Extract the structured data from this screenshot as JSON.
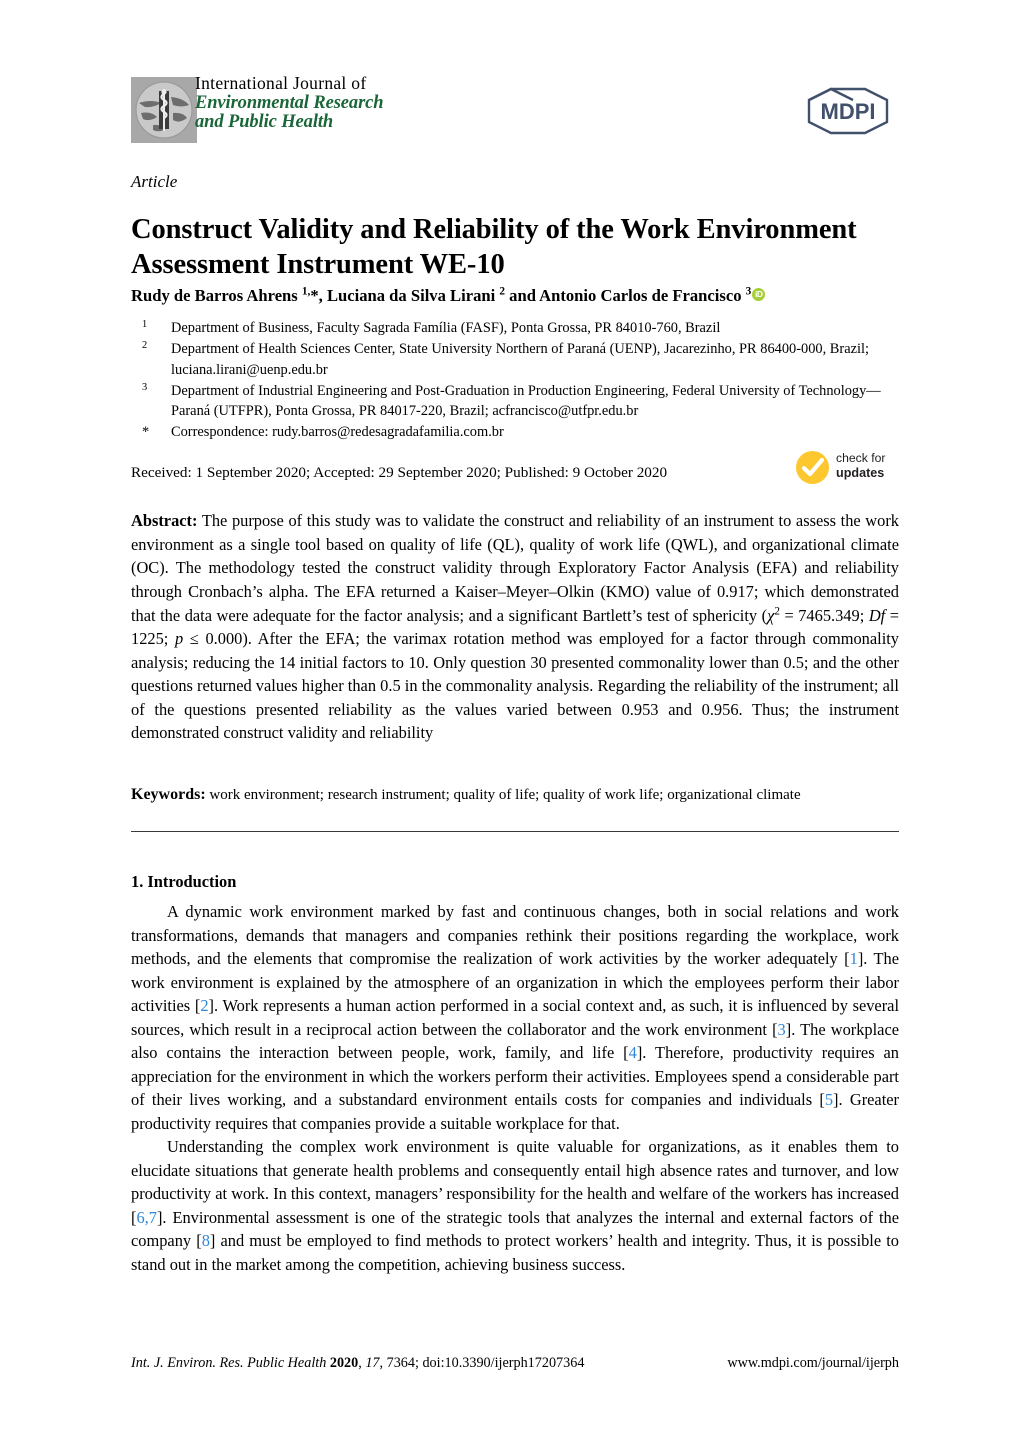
{
  "masthead": {
    "journal_line1": "International  Journal  of",
    "journal_line2": "Environmental Research",
    "journal_line3": "and Public Health",
    "publisher_logo_text": "MDPI",
    "journal_logo_name": "ijerph-globe-caduceus-logo",
    "green_hex": "#1b6638",
    "mdpi_navy_hex": "#41506b"
  },
  "article": {
    "type": "Article",
    "title": "Construct Validity and Reliability of the Work Environment Assessment Instrument WE-10"
  },
  "authors": {
    "line_html": "Rudy de Barros Ahrens <sup>1,</sup>*, Luciana da Silva Lirani <sup>2</sup> and Antonio Carlos de Francisco <sup>3</sup>",
    "orcid_label": "iD",
    "orcid_color": "#a6ce39"
  },
  "affiliations": [
    {
      "marker": "1",
      "text": "Department of Business, Faculty Sagrada Família (FASF), Ponta Grossa, PR 84010-760, Brazil"
    },
    {
      "marker": "2",
      "text": "Department of Health Sciences Center, State University Northern of Paraná (UENP), Jacarezinho, PR 86400-000, Brazil; luciana.lirani@uenp.edu.br"
    },
    {
      "marker": "3",
      "text": "Department of Industrial Engineering and Post-Graduation in Production Engineering, Federal University of Technology—Paraná (UTFPR), Ponta Grossa, PR 84017-220, Brazil; acfrancisco@utfpr.edu.br"
    },
    {
      "marker": "*",
      "text": "Correspondence: rudy.barros@redesagradafamilia.com.br"
    }
  ],
  "dates": {
    "line": "Received: 1 September 2020; Accepted: 29 September 2020; Published: 9 October 2020"
  },
  "check_for_updates": {
    "line1": "check for",
    "line2": "updates",
    "badge_color": "#fdc82f"
  },
  "abstract": {
    "label": "Abstract:",
    "text_html": "The purpose of this study was to validate the construct and reliability of an instrument to assess the work environment as a single tool based on quality of life (QL), quality of work life (QWL), and organizational climate (OC). The methodology tested the construct validity through Exploratory Factor Analysis (EFA) and reliability through Cronbach&rsquo;s alpha. The EFA returned a Kaiser&ndash;Meyer&ndash;Olkin (KMO) value of 0.917; which demonstrated that the data were adequate for the factor analysis; and a significant Bartlett&rsquo;s test of sphericity (<i>&chi;</i><sup>2</sup> = 7465.349; <i>Df</i> = 1225; <i>p</i> &le; 0.000). After the EFA; the varimax rotation method was employed for a factor through commonality analysis; reducing the 14 initial factors to 10. Only question 30 presented commonality lower than 0.5; and the other questions returned values higher than 0.5 in the commonality analysis. Regarding the reliability of the instrument; all of the questions presented reliability as the values varied between 0.953 and 0.956. Thus; the instrument demonstrated construct validity and reliability"
  },
  "keywords": {
    "label": "Keywords:",
    "text": "work environment; research instrument; quality of life; quality of work life; organizational climate"
  },
  "introduction": {
    "heading": "1. Introduction",
    "paragraph1_html": "A dynamic work environment marked by fast and continuous changes, both in social relations and work transformations, demands that managers and companies rethink their positions regarding the workplace, work methods, and the elements that compromise the realization of work activities by the worker adequately [<span class=\"cite\">1</span>]. The work environment is explained by the atmosphere of an organization in which the employees perform their labor activities [<span class=\"cite\">2</span>]. Work represents a human action performed in a social context and, as such, it is influenced by several sources, which result in a reciprocal action between the collaborator and the work environment [<span class=\"cite\">3</span>]. The workplace also contains the interaction between people, work, family, and life [<span class=\"cite\">4</span>]. Therefore, productivity requires an appreciation for the environment in which the workers perform their activities. Employees spend a considerable part of their lives working, and a substandard environment entails costs for companies and individuals [<span class=\"cite\">5</span>]. Greater productivity requires that companies provide a suitable workplace for that.",
    "paragraph2_html": "Understanding the complex work environment is quite valuable for organizations, as it enables them to elucidate situations that generate health problems and consequently entail high absence rates and turnover, and low productivity at work. In this context, managers&rsquo; responsibility for the health and welfare of the workers has increased [<span class=\"cite\">6,7</span>]. Environmental assessment is one of the strategic tools that analyzes the internal and external factors of the company [<span class=\"cite\">8</span>] and must be employed to find methods to protect workers&rsquo; health and integrity. Thus, it is possible to stand out in the market among the competition, achieving business success.",
    "citation_color": "#2e86d8"
  },
  "footer": {
    "left_html": "<i>Int. J. Environ. Res. Public Health</i> <b>2020</b>, <i>17</i>, 7364; doi:10.3390/ijerph17207364",
    "right": "www.mdpi.com/journal/ijerph"
  }
}
